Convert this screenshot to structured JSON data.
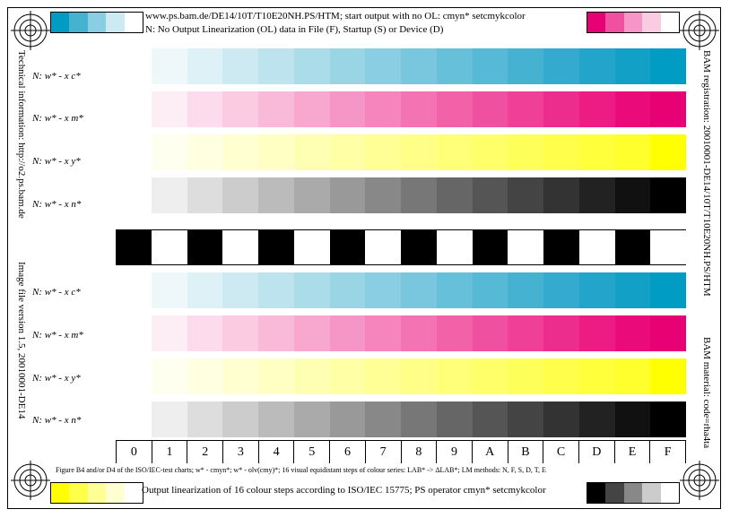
{
  "header": {
    "line1": "www.ps.bam.de/DE14/10T/T10E20NH.PS/HTM; start output with no OL: cmyn* setcmykcolor",
    "line2": "N: No Output Linearization (OL) data in File (F), Startup (S) or Device (D)"
  },
  "left_vertical": {
    "top": "Technical information: http://o2.ps.bam.de",
    "bottom": "Image file version 1.5, 20010001-DE14"
  },
  "right_vertical": {
    "top": "BAM registration: 20010001-DE14/10T/T10E20NH.PS/HTM",
    "bottom": "BAM material: code=rha4ta"
  },
  "row_labels": [
    "N: w* - x c*",
    "N: w* - x m*",
    "N: w* - x y*",
    "N: w* - x n*",
    "N: w* - x c*",
    "N: w* - x m*",
    "N: w* - x y*",
    "N: w* - x n*"
  ],
  "step_labels": [
    "0",
    "1",
    "2",
    "3",
    "4",
    "5",
    "6",
    "7",
    "8",
    "9",
    "A",
    "B",
    "C",
    "D",
    "E",
    "F"
  ],
  "caption": "Figure B4 and/or D4 of the ISO/IEC-test charts; w* - cmyn*; w* - olv(cmy)*; 16 visual equidistant steps of colour series: LAB* -> ΔLAB*; LM methods: N, F, S, D, T, E",
  "footer": "Output linearization of 16 colour steps according to ISO/IEC 15775; PS operator cmyn* setcmykcolor",
  "colors": {
    "cyan": [
      "#ffffff",
      "#eef8fb",
      "#ddf1f7",
      "#cdeaf2",
      "#bce3ee",
      "#abdcea",
      "#9ad5e6",
      "#89cee2",
      "#78c7de",
      "#67c0da",
      "#56b9d6",
      "#45b2d2",
      "#34abce",
      "#23a4ca",
      "#12a0c6",
      "#009cc4"
    ],
    "magenta": [
      "#ffffff",
      "#fdeef5",
      "#fcdcec",
      "#fbcbe2",
      "#f9b9d9",
      "#f8a8cf",
      "#f696c6",
      "#f585bc",
      "#f373b3",
      "#f262a9",
      "#f050a0",
      "#ef3f96",
      "#ed2d8d",
      "#ec1c83",
      "#ea0a7a",
      "#e80075"
    ],
    "yellow": [
      "#ffffff",
      "#fffff0",
      "#ffffe1",
      "#ffffd2",
      "#ffffc3",
      "#ffffb4",
      "#ffffa5",
      "#ffff96",
      "#ffff87",
      "#ffff78",
      "#ffff69",
      "#ffff5a",
      "#ffff4b",
      "#ffff3c",
      "#ffff2d",
      "#ffff00"
    ],
    "black": [
      "#ffffff",
      "#eeeeee",
      "#dddddd",
      "#cccccc",
      "#bbbbbb",
      "#aaaaaa",
      "#999999",
      "#888888",
      "#777777",
      "#666666",
      "#555555",
      "#444444",
      "#333333",
      "#222222",
      "#111111",
      "#000000"
    ]
  },
  "top_left_swatches": [
    "#009cc4",
    "#45b2d2",
    "#89cee2",
    "#cdeaf2",
    "#ffffff"
  ],
  "top_right_swatches": [
    "#e80075",
    "#f050a0",
    "#f696c6",
    "#fbcbe2",
    "#ffffff"
  ],
  "bottom_left_swatches": [
    "#ffff00",
    "#ffff4b",
    "#ffff96",
    "#ffffd2",
    "#ffffff"
  ],
  "bottom_right_swatches": [
    "#000000",
    "#444444",
    "#888888",
    "#cccccc",
    "#ffffff"
  ]
}
